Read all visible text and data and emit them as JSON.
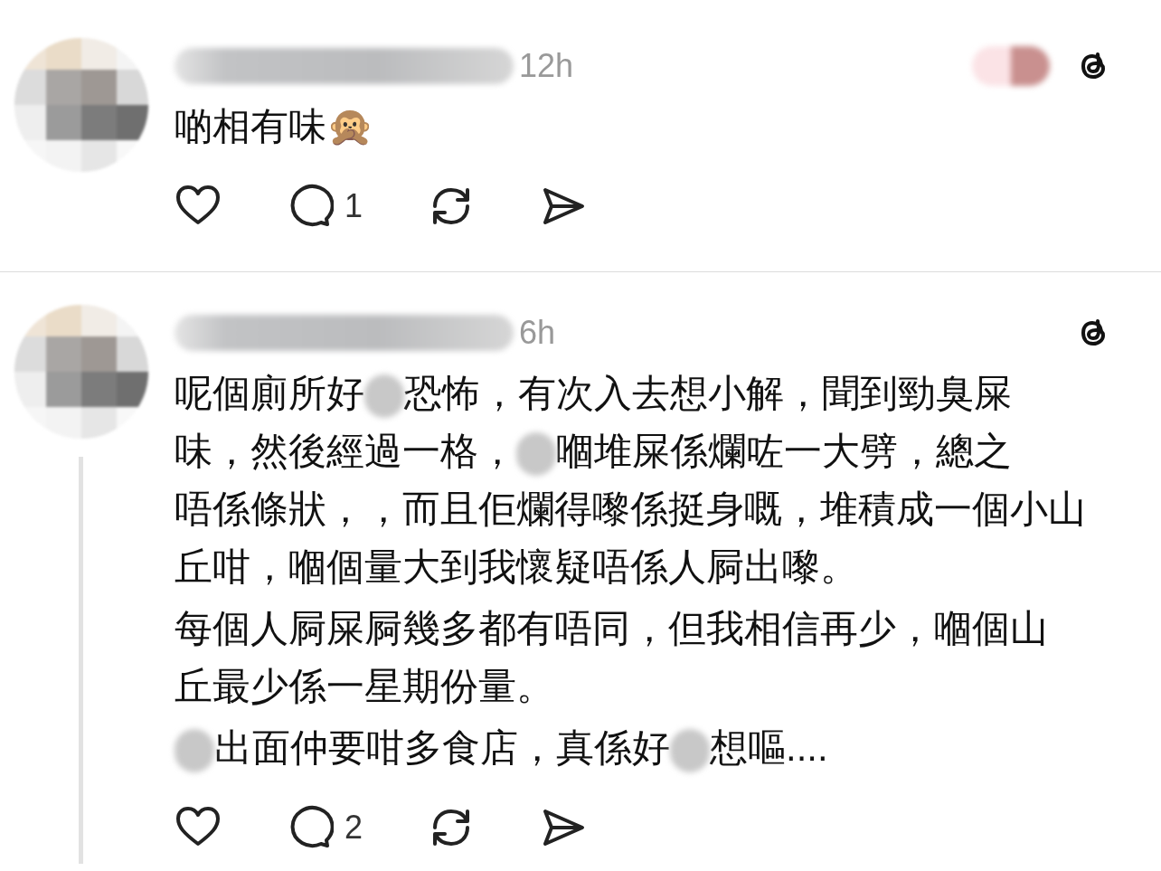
{
  "posts": [
    {
      "time": "12h",
      "has_thread_line": false,
      "has_side_mark": true,
      "paragraphs": [
        [
          [
            {
              "kind": "text",
              "text": "啲相有味🙊"
            }
          ]
        ]
      ],
      "reply_count": "1"
    },
    {
      "time": "6h",
      "has_thread_line": true,
      "has_side_mark": false,
      "paragraphs": [
        [
          [
            {
              "kind": "text",
              "text": "呢個廁所好"
            },
            {
              "kind": "blur"
            },
            {
              "kind": "text",
              "text": "恐怖，有次入去想小解，聞到勁臭屎"
            }
          ],
          [
            {
              "kind": "text",
              "text": "味，然後經過一格，"
            },
            {
              "kind": "blur"
            },
            {
              "kind": "text",
              "text": "嗰堆屎係爛咗一大劈，總之"
            }
          ],
          [
            {
              "kind": "text",
              "text": "唔係條狀，，而且佢爛得嚟係挺身嘅，堆積成一個小山"
            }
          ],
          [
            {
              "kind": "text",
              "text": "丘咁，嗰個量大到我懷疑唔係人屙出嚟。"
            }
          ]
        ],
        [
          [
            {
              "kind": "text",
              "text": "每個人屙屎屙幾多都有唔同，但我相信再少，嗰個山"
            }
          ],
          [
            {
              "kind": "text",
              "text": "丘最少係一星期份量。"
            }
          ]
        ],
        [
          [
            {
              "kind": "blur"
            },
            {
              "kind": "text",
              "text": "出面仲要咁多食店，真係好"
            },
            {
              "kind": "blur"
            },
            {
              "kind": "text",
              "text": "想嘔...."
            }
          ]
        ]
      ],
      "reply_count": "2"
    }
  ]
}
